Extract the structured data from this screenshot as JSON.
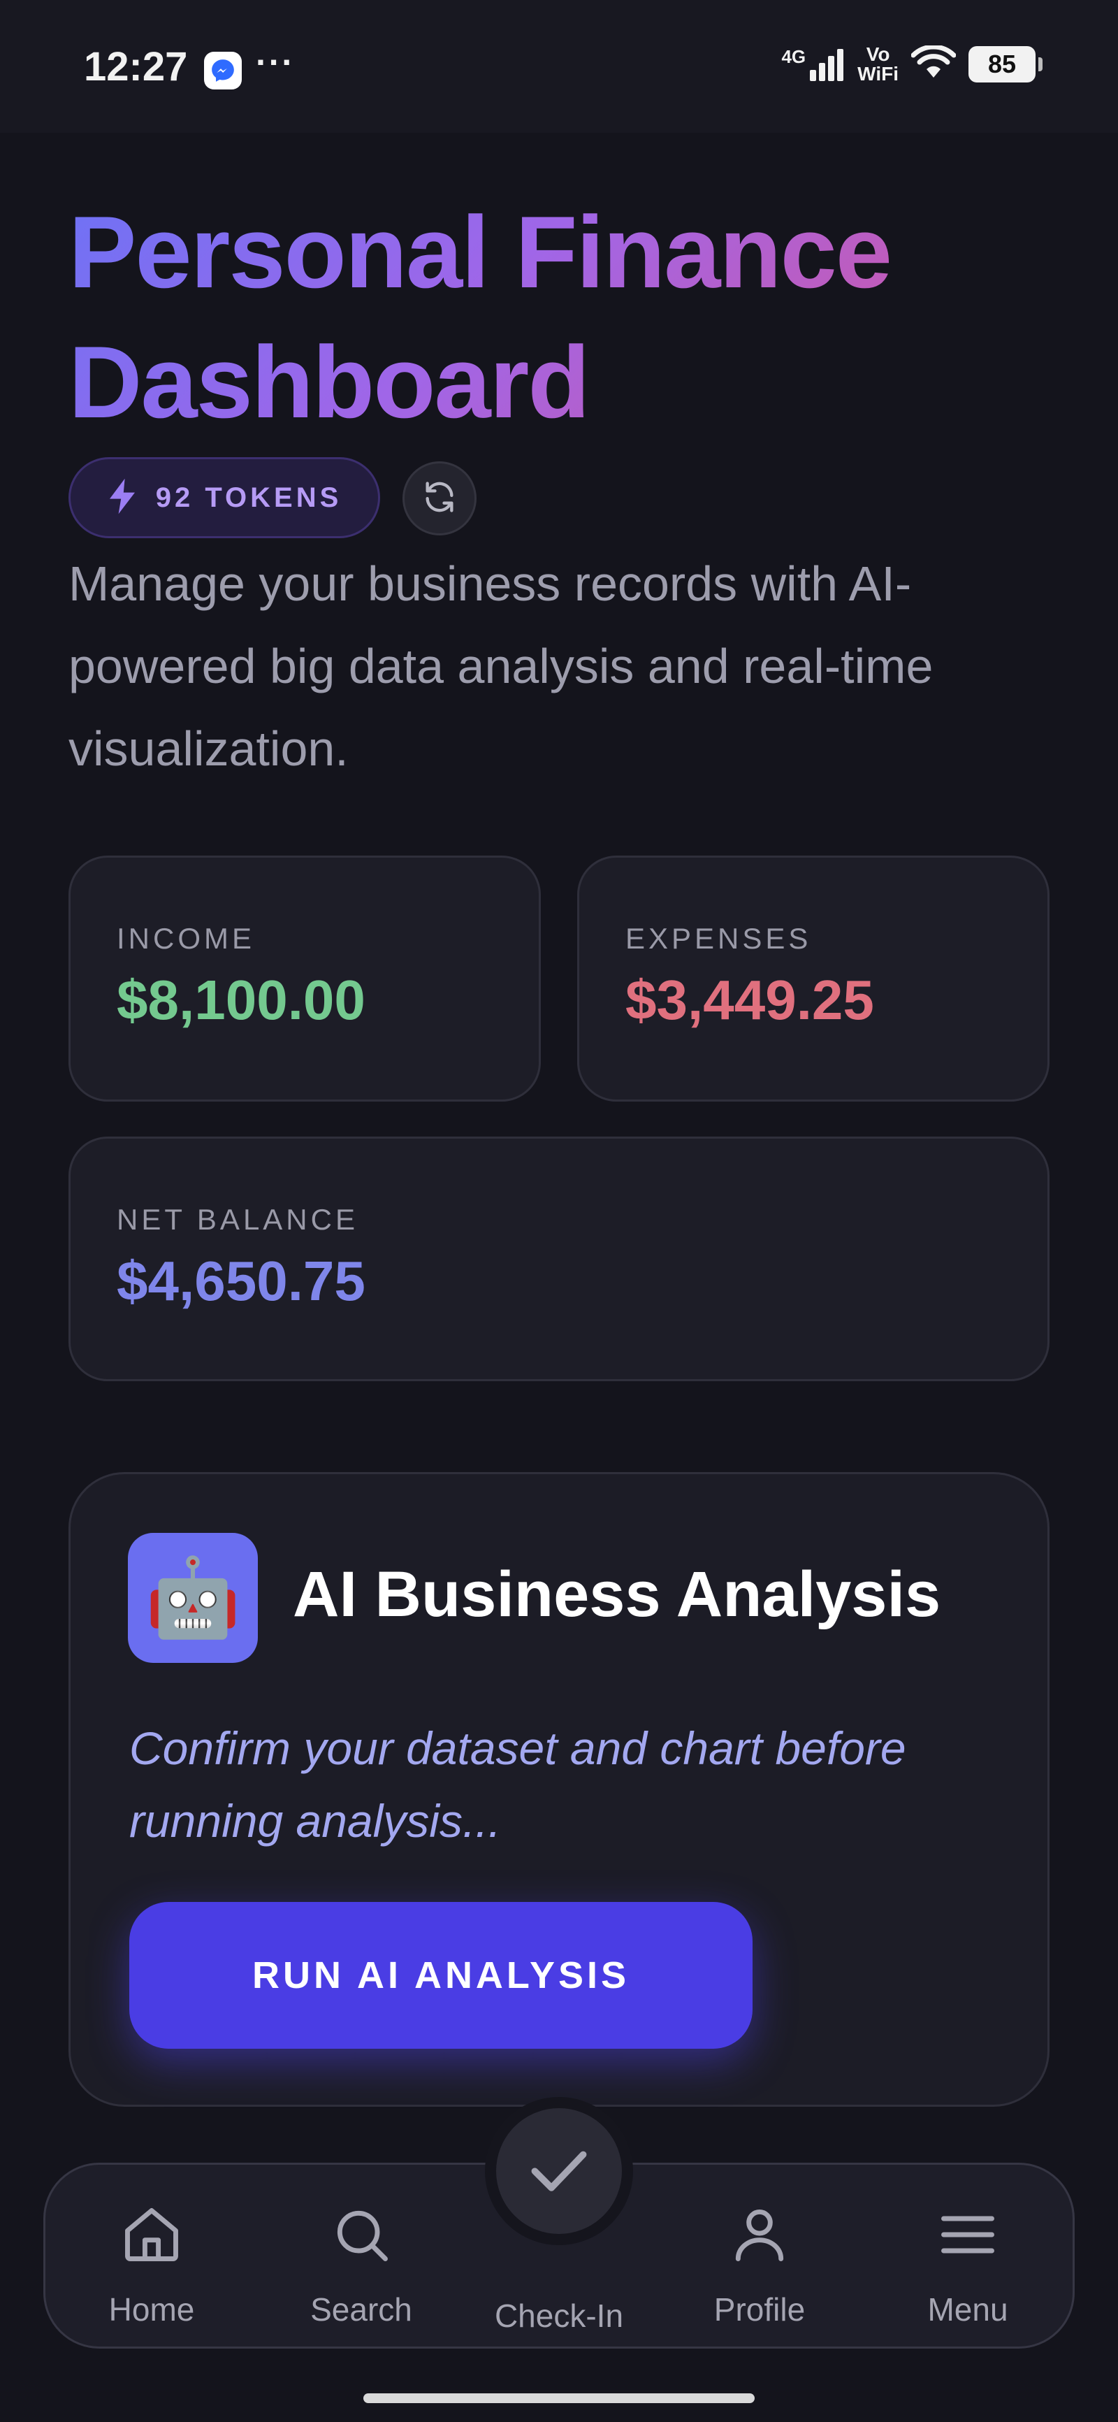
{
  "status_bar": {
    "time": "12:27",
    "dots": "···",
    "network": "4G",
    "vowifi_top": "Vo",
    "vowifi_bottom": "WiFi",
    "battery": "85"
  },
  "header": {
    "title": "Personal Finance Dashboard",
    "tokens_label": "92 TOKENS",
    "subtitle": "Manage your business records with AI-powered big data analysis and real-time visualization."
  },
  "stats": {
    "income": {
      "label": "INCOME",
      "value": "$8,100.00"
    },
    "expenses": {
      "label": "EXPENSES",
      "value": "$3,449.25"
    },
    "net_balance": {
      "label": "NET BALANCE",
      "value": "$4,650.75"
    }
  },
  "ai_analysis": {
    "icon": "🤖",
    "title": "AI Business Analysis",
    "description": "Confirm your dataset and chart before running analysis...",
    "button_label": "RUN AI ANALYSIS"
  },
  "bottom_nav": {
    "home": "Home",
    "search": "Search",
    "check_in": "Check-In",
    "profile": "Profile",
    "menu": "Menu"
  },
  "colors": {
    "income": "#74c98f",
    "expenses": "#e0707e",
    "net_balance": "#7f86ea",
    "accent": "#4a3de4"
  }
}
